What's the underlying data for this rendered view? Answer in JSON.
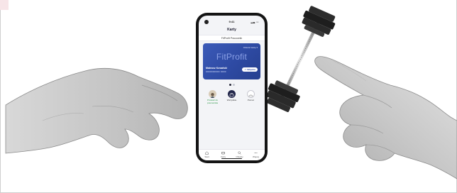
{
  "status_bar": {
    "time": "9:41"
  },
  "header": {
    "title": "Karty"
  },
  "card_owner_strip": {
    "text": "FitProfit Pracownik"
  },
  "card": {
    "link_label": "Odwróć kartę",
    "logo_text": "FitProfit",
    "holder_name": "Mateusz Kowalski",
    "card_number": "0000000000 0000",
    "action_button_label": "Aktywne",
    "gradient_color": "#2e4aa3"
  },
  "pager": {
    "count": 2,
    "active_index": 0
  },
  "quick_actions": [
    {
      "label": "Przekaż do pracownika",
      "icon": "user-photo-icon",
      "color": "#2e9a48"
    },
    {
      "label": "Wszystkie",
      "icon": "cards-stack-icon"
    },
    {
      "label": "Pomoc",
      "icon": "help-icon"
    }
  ],
  "tab_bar": [
    {
      "label": "Start",
      "icon": "home-icon"
    },
    {
      "label": "Karty",
      "icon": "card-icon"
    },
    {
      "label": "Obiekty",
      "icon": "search-icon"
    },
    {
      "label": "Więcej",
      "icon": "more-icon"
    }
  ],
  "colors": {
    "accent_blue": "#2e4aa3",
    "accent_green": "#2e9a48",
    "corner_pink": "#f7e5e8"
  }
}
